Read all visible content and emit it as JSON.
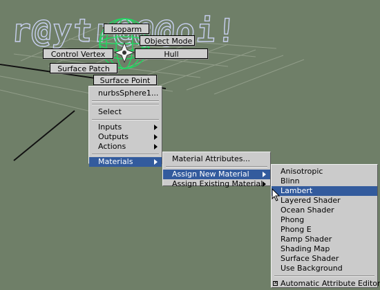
{
  "viewport": {
    "background_text": "r@ytr@@@oi!",
    "colors": {
      "background": "#6f7f68",
      "highlight": "#335b9d",
      "menu_bg": "#cbcbcb"
    }
  },
  "marking_menu": {
    "isoparm": "Isoparm",
    "object_mode": "Object Mode",
    "control_vertex": "Control Vertex",
    "hull": "Hull",
    "surface_patch": "Surface Patch",
    "surface_point": "Surface Point"
  },
  "main_menu": {
    "object_name": "nurbsSphere1...",
    "select": "Select",
    "inputs": "Inputs",
    "outputs": "Outputs",
    "actions": "Actions",
    "materials": "Materials"
  },
  "materials_menu": {
    "material_attributes": "Material Attributes...",
    "assign_new_material": "Assign New Material",
    "assign_existing_material": "Assign Existing Material"
  },
  "new_material_menu": {
    "items": [
      "Anisotropic",
      "Blinn",
      "Lambert",
      "Layered Shader",
      "Ocean Shader",
      "Phong",
      "Phong E",
      "Ramp Shader",
      "Shading Map",
      "Surface Shader",
      "Use Background"
    ],
    "highlighted": "Lambert",
    "automatic_attribute_editor": "Automatic Attribute Editor",
    "automatic_attribute_editor_checked": true
  }
}
